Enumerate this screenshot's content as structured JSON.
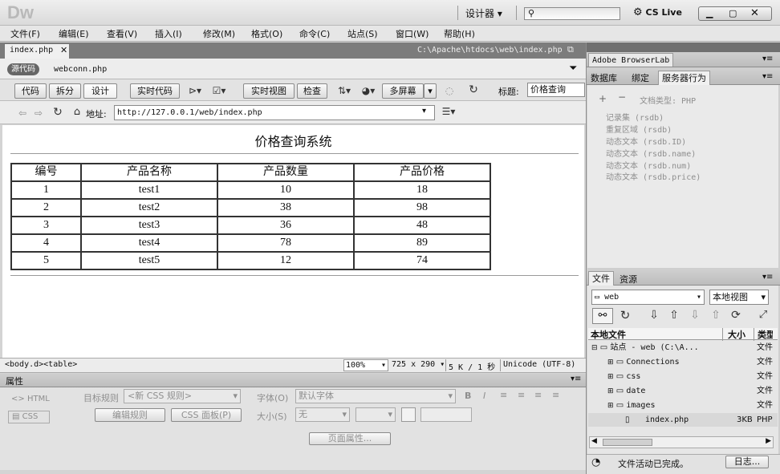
{
  "app": {
    "logo": "Dw",
    "workspace": "设计器",
    "cs_live": "CS Live"
  },
  "menu": [
    "文件(F)",
    "编辑(E)",
    "查看(V)",
    "插入(I)",
    "修改(M)",
    "格式(O)",
    "命令(C)",
    "站点(S)",
    "窗口(W)",
    "帮助(H)"
  ],
  "doc": {
    "tab": "index.php",
    "path": "C:\\Apache\\htdocs\\web\\index.php",
    "source_label": "源代码",
    "related_file": "webconn.php"
  },
  "toolbar": {
    "code": "代码",
    "split": "拆分",
    "design": "设计",
    "live_code": "实时代码",
    "live_view": "实时视图",
    "inspect": "检查",
    "multiscreen": "多屏幕",
    "title_label": "标题:",
    "title_value": "价格查询"
  },
  "browser": {
    "address_label": "地址:",
    "address_value": "http://127.0.0.1/web/index.php"
  },
  "page": {
    "heading": "价格查询系统",
    "table_headers": [
      "编号",
      "产品名称",
      "产品数量",
      "产品价格"
    ],
    "rows": [
      [
        "1",
        "test1",
        "10",
        "18"
      ],
      [
        "2",
        "test2",
        "38",
        "98"
      ],
      [
        "3",
        "test3",
        "36",
        "48"
      ],
      [
        "4",
        "test4",
        "78",
        "89"
      ],
      [
        "5",
        "test5",
        "12",
        "74"
      ]
    ]
  },
  "status": {
    "tags": "<body.d><table>",
    "zoom": "100%",
    "size": "725 x 290",
    "filesize": "5 K / 1 秒",
    "encoding": "Unicode (UTF-8)"
  },
  "props": {
    "title": "属性",
    "html": "HTML",
    "css": "CSS",
    "target_rule_label": "目标规则",
    "target_rule_value": "<新 CSS 规则>",
    "font_label": "字体(O)",
    "font_value": "默认字体",
    "size_label": "大小(S)",
    "size_value": "无",
    "edit_rule": "编辑规则",
    "css_panel": "CSS 面板(P)",
    "page_props": "页面属性..."
  },
  "panels": {
    "browserlab": "Adobe BrowserLab",
    "tabs": [
      "数据库",
      "绑定",
      "服务器行为"
    ],
    "doc_type": "文档类型: PHP",
    "behaviors": [
      "记录集 (rsdb)",
      "重复区域 (rsdb)",
      "动态文本 (rsdb.ID)",
      "动态文本 (rsdb.name)",
      "动态文本 (rsdb.num)",
      "动态文本 (rsdb.price)"
    ]
  },
  "files": {
    "tabs": [
      "文件",
      "资源"
    ],
    "site": "web",
    "view": "本地视图",
    "col_local": "本地文件",
    "col_size": "大小",
    "col_type": "类型",
    "tree": [
      {
        "name": "站点 - web (C:\\A...",
        "size": "",
        "type": "文件"
      },
      {
        "name": "Connections",
        "size": "",
        "type": "文件"
      },
      {
        "name": "css",
        "size": "",
        "type": "文件"
      },
      {
        "name": "date",
        "size": "",
        "type": "文件"
      },
      {
        "name": "images",
        "size": "",
        "type": "文件"
      },
      {
        "name": "index.php",
        "size": "3KB",
        "type": "PHP"
      }
    ],
    "status": "文件活动已完成。",
    "log": "日志..."
  }
}
